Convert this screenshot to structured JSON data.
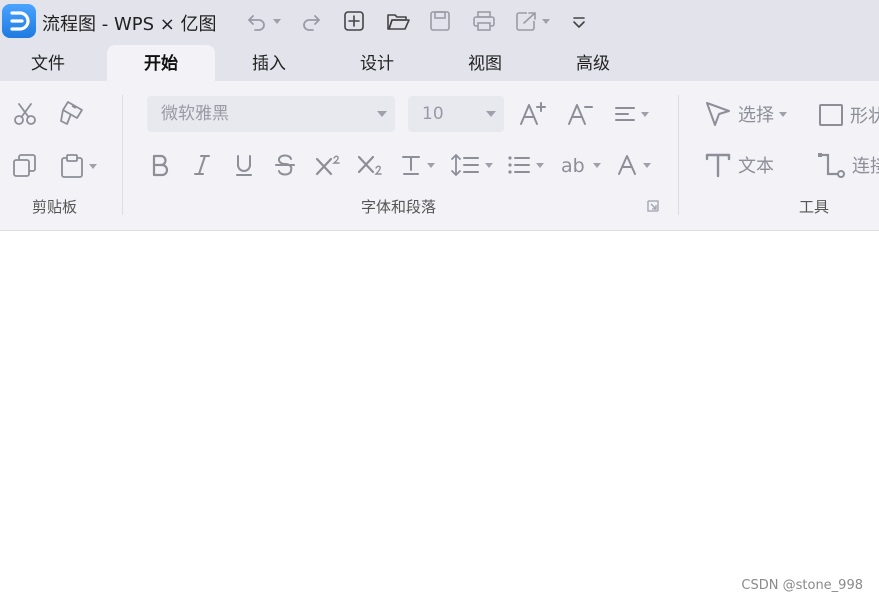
{
  "window": {
    "title": "流程图 - WPS × 亿图",
    "logo_icon": "wps-edraw-logo-icon",
    "brand_color": "#1f7ae0"
  },
  "quick_access": [
    "undo-icon",
    "redo-icon",
    "new-page-icon",
    "open-folder-icon",
    "save-icon",
    "print-icon",
    "export-icon",
    "more-chevron-icon"
  ],
  "tabs": [
    {
      "label": "文件",
      "active": false
    },
    {
      "label": "开始",
      "active": true
    },
    {
      "label": "插入",
      "active": false
    },
    {
      "label": "设计",
      "active": false
    },
    {
      "label": "视图",
      "active": false
    },
    {
      "label": "高级",
      "active": false
    }
  ],
  "ribbon": {
    "clipboard": {
      "label": "剪贴板"
    },
    "font": {
      "label": "字体和段落",
      "font_family": "微软雅黑",
      "font_size": "10"
    },
    "tools": {
      "label": "工具",
      "select_label": "选择",
      "shape_label": "形状",
      "text_label": "文本",
      "connector_label": "连接线"
    }
  },
  "watermark": "CSDN @stone_998"
}
